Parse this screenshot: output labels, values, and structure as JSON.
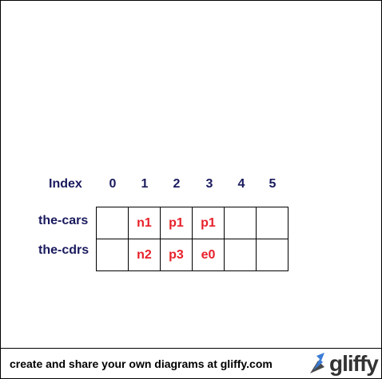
{
  "diagram": {
    "index_header": "Index",
    "indices": [
      "0",
      "1",
      "2",
      "3",
      "4",
      "5"
    ],
    "rows": [
      {
        "label": "the-cars",
        "cells": [
          "",
          "n1",
          "p1",
          "p1",
          "",
          ""
        ]
      },
      {
        "label": "the-cdrs",
        "cells": [
          "",
          "n2",
          "p3",
          "e0",
          "",
          ""
        ]
      }
    ]
  },
  "footer": {
    "text": "create and share your own diagrams at gliffy.com",
    "logo_text": "gliffy"
  },
  "colors": {
    "label": "#1a1a5e",
    "cell_value": "#e8202a",
    "logo_arrow": "#3a7bd5"
  }
}
